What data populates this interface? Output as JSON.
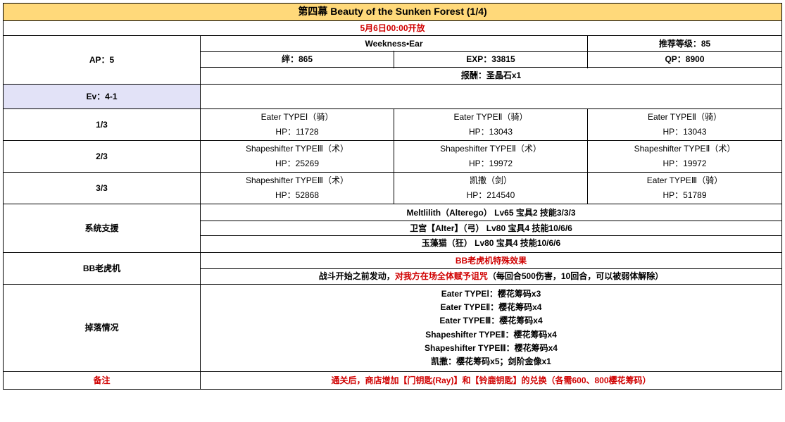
{
  "title": "第四幕 Beauty of the Sunken Forest (1/4)",
  "openDate": "5月6日00:00开放",
  "ap": {
    "label": "AP：5"
  },
  "weakness": "Weekness•Ear",
  "recLevel": "推荐等级：85",
  "bond": "绊：865",
  "exp": "EXP：33815",
  "qp": "QP：8900",
  "reward": "报酬：圣晶石x1",
  "evLabel": "Ev：4-1",
  "waves": [
    {
      "label": "1/3",
      "enemies": [
        {
          "name": "Eater TYPEⅠ（骑）",
          "hp": "HP：11728"
        },
        {
          "name": "Eater TYPEⅡ（骑）",
          "hp": "HP：13043"
        },
        {
          "name": "Eater TYPEⅡ（骑）",
          "hp": "HP：13043"
        }
      ]
    },
    {
      "label": "2/3",
      "enemies": [
        {
          "name": "Shapeshifter TYPEⅢ（术）",
          "hp": "HP：25269"
        },
        {
          "name": "Shapeshifter TYPEⅡ（术）",
          "hp": "HP：19972"
        },
        {
          "name": "Shapeshifter TYPEⅡ（术）",
          "hp": "HP：19972"
        }
      ]
    },
    {
      "label": "3/3",
      "enemies": [
        {
          "name": "Shapeshifter TYPEⅢ（术）",
          "hp": "HP：52868"
        },
        {
          "name": "凯撒（剑）",
          "hp": "HP：214540"
        },
        {
          "name": "Eater TYPEⅢ（骑）",
          "hp": "HP：51789"
        }
      ]
    }
  ],
  "support": {
    "label": "系统支援",
    "lines": [
      "Meltlilith（Alterego） Lv65 宝具2 技能3/3/3",
      "卫宫【Alter】（弓） Lv80 宝具4 技能10/6/6",
      "玉藻猫（狂） Lv80 宝具4 技能10/6/6"
    ]
  },
  "bbSlot": {
    "label": "BB老虎机",
    "title": "BB老虎机特殊效果",
    "effect_pre": "战斗开始之前发动，",
    "effect_red": "对我方在场全体赋予诅咒",
    "effect_post": "（每回合500伤害，10回合，可以被弱体解除）"
  },
  "drops": {
    "label": "掉落情况",
    "lines": [
      "Eater TYPEⅠ：樱花筹码x3",
      "Eater TYPEⅡ：樱花筹码x4",
      "Eater TYPEⅢ：樱花筹码x4",
      "Shapeshifter TYPEⅡ：樱花筹码x4",
      "Shapeshifter TYPEⅢ：樱花筹码x4",
      "凯撒：樱花筹码x5；剑阶金像x1"
    ]
  },
  "remark": {
    "label": "备注",
    "text": "通关后，商店增加【门钥匙(Ray)】和【铃鹿钥匙】的兑换（各需600、800樱花筹码）"
  }
}
